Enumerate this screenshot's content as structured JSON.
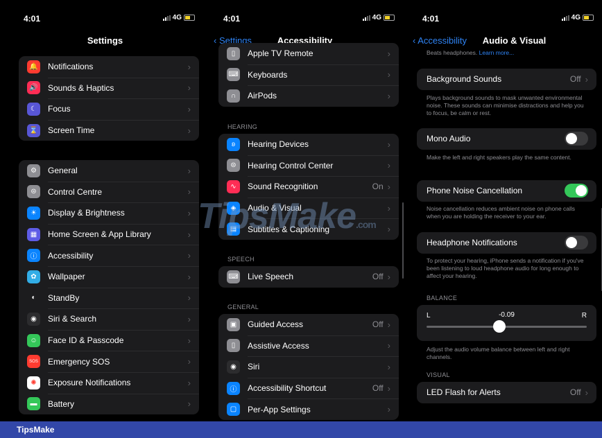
{
  "status": {
    "time": "4:01",
    "network": "4G"
  },
  "settings": {
    "title": "Settings",
    "group1": [
      {
        "label": "Notifications",
        "icon": "bell-icon",
        "color": "#ff3b30"
      },
      {
        "label": "Sounds & Haptics",
        "icon": "speaker-icon",
        "color": "#ff2d55"
      },
      {
        "label": "Focus",
        "icon": "moon-icon",
        "color": "#5856d6"
      },
      {
        "label": "Screen Time",
        "icon": "hourglass-icon",
        "color": "#5856d6"
      }
    ],
    "group2": [
      {
        "label": "General",
        "icon": "gear-icon",
        "color": "#8e8e93"
      },
      {
        "label": "Control Centre",
        "icon": "switches-icon",
        "color": "#8e8e93"
      },
      {
        "label": "Display & Brightness",
        "icon": "sun-icon",
        "color": "#0a84ff"
      },
      {
        "label": "Home Screen & App Library",
        "icon": "grid-icon",
        "color": "#5e5ce6"
      },
      {
        "label": "Accessibility",
        "icon": "accessibility-icon",
        "color": "#0a84ff"
      },
      {
        "label": "Wallpaper",
        "icon": "flower-icon",
        "color": "#32ade6"
      },
      {
        "label": "StandBy",
        "icon": "standby-icon",
        "color": "#1c1c1e"
      },
      {
        "label": "Siri & Search",
        "icon": "siri-icon",
        "color": "#2c2c2e"
      },
      {
        "label": "Face ID & Passcode",
        "icon": "faceid-icon",
        "color": "#34c759"
      },
      {
        "label": "Emergency SOS",
        "icon": "sos-icon",
        "color": "#ff3b30"
      },
      {
        "label": "Exposure Notifications",
        "icon": "exposure-icon",
        "color": "#ffffff"
      },
      {
        "label": "Battery",
        "icon": "battery-icon",
        "color": "#34c759"
      }
    ]
  },
  "accessibility": {
    "back": "Settings",
    "title": "Accessibility",
    "top": [
      {
        "label": "Apple TV Remote",
        "icon": "remote-icon",
        "color": "#8e8e93",
        "value": ""
      },
      {
        "label": "Keyboards",
        "icon": "keyboard-icon",
        "color": "#8e8e93",
        "value": ""
      },
      {
        "label": "AirPods",
        "icon": "airpods-icon",
        "color": "#8e8e93",
        "value": ""
      }
    ],
    "hearing_header": "HEARING",
    "hearing": [
      {
        "label": "Hearing Devices",
        "icon": "ear-icon",
        "color": "#0a84ff",
        "value": ""
      },
      {
        "label": "Hearing Control Center",
        "icon": "switches-icon",
        "color": "#8e8e93",
        "value": ""
      },
      {
        "label": "Sound Recognition",
        "icon": "waveform-icon",
        "color": "#ff2d55",
        "value": "On"
      },
      {
        "label": "Audio & Visual",
        "icon": "speaker-eye-icon",
        "color": "#0a84ff",
        "value": ""
      },
      {
        "label": "Subtitles & Captioning",
        "icon": "captions-icon",
        "color": "#0a84ff",
        "value": ""
      }
    ],
    "speech_header": "SPEECH",
    "speech": [
      {
        "label": "Live Speech",
        "icon": "keyboard-speech-icon",
        "color": "#8e8e93",
        "value": "Off"
      }
    ],
    "general_header": "GENERAL",
    "general": [
      {
        "label": "Guided Access",
        "icon": "lock-icon",
        "color": "#8e8e93",
        "value": "Off"
      },
      {
        "label": "Assistive Access",
        "icon": "phone-icon",
        "color": "#8e8e93",
        "value": ""
      },
      {
        "label": "Siri",
        "icon": "siri-icon",
        "color": "#2c2c2e",
        "value": ""
      },
      {
        "label": "Accessibility Shortcut",
        "icon": "accessibility-icon",
        "color": "#0a84ff",
        "value": "Off"
      },
      {
        "label": "Per-App Settings",
        "icon": "app-settings-icon",
        "color": "#0a84ff",
        "value": ""
      }
    ]
  },
  "audio_visual": {
    "back": "Accessibility",
    "title": "Audio & Visual",
    "top_note": "Beats headphones.",
    "learn_more": "Learn more...",
    "background_sounds": {
      "label": "Background Sounds",
      "value": "Off"
    },
    "background_note": "Plays background sounds to mask unwanted environmental noise. These sounds can minimise distractions and help you to focus, be calm or rest.",
    "mono_audio": {
      "label": "Mono Audio",
      "on": false
    },
    "mono_note": "Make the left and right speakers play the same content.",
    "phone_noise": {
      "label": "Phone Noise Cancellation",
      "on": true
    },
    "noise_note": "Noise cancellation reduces ambient noise on phone calls when you are holding the receiver to your ear.",
    "headphone_notif": {
      "label": "Headphone Notifications",
      "on": false
    },
    "headphone_note": "To protect your hearing, iPhone sends a notification if you've been listening to loud headphone audio for long enough to affect your hearing.",
    "balance_header": "BALANCE",
    "balance": {
      "left": "L",
      "right": "R",
      "value": "-0.09",
      "position": -0.09
    },
    "balance_note": "Adjust the audio volume balance between left and right channels.",
    "visual_header": "VISUAL",
    "led_flash": {
      "label": "LED Flash for Alerts",
      "value": "Off"
    }
  },
  "watermark": {
    "text": "TipsMake",
    "suffix": ".com"
  },
  "footer": {
    "brand": "TipsMake"
  }
}
